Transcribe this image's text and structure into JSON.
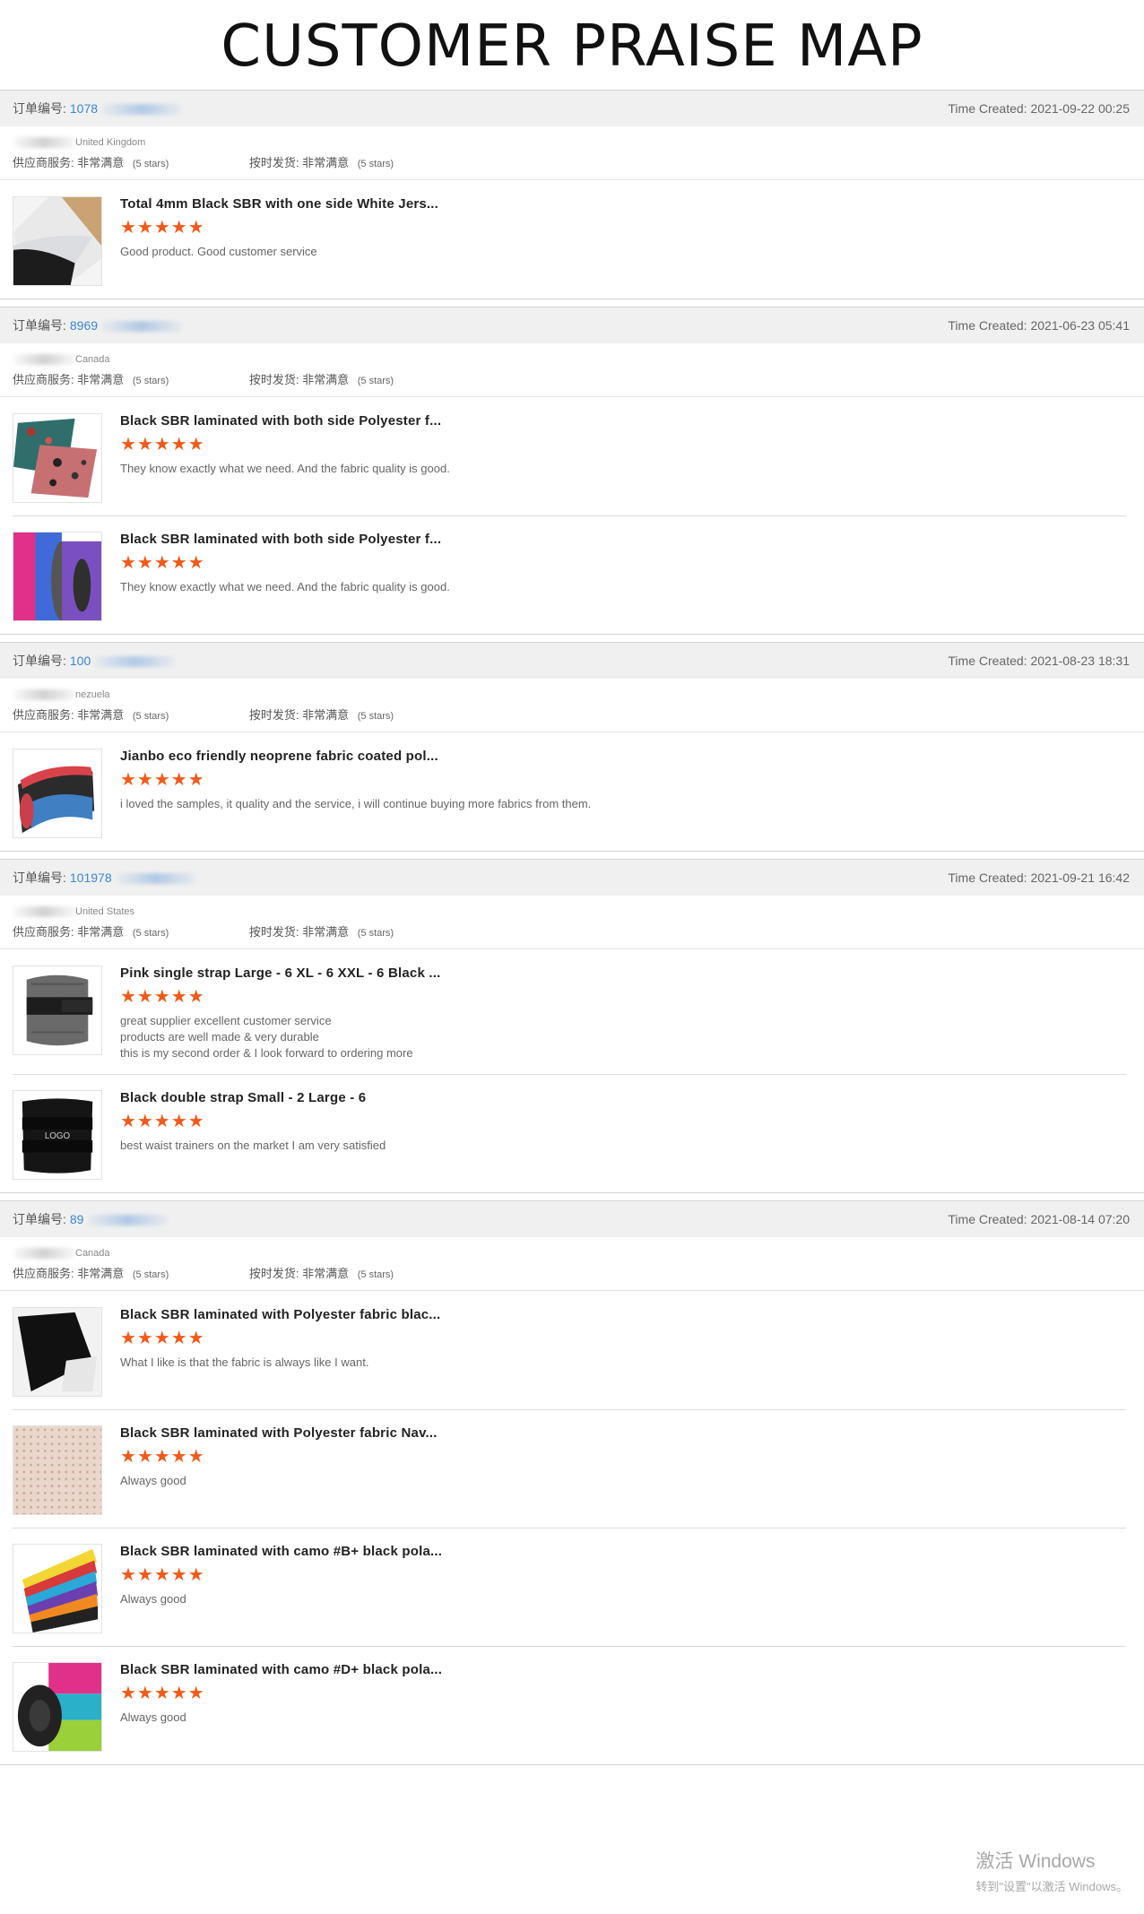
{
  "title": "CUSTOMER PRAISE MAP",
  "labels": {
    "order_no": "订单编号:",
    "supplier_service": "供应商服务:",
    "on_time_shipping": "按时发货:",
    "very_satisfied": "非常满意",
    "five_stars": "(5 stars)",
    "stars": "★★★★★"
  },
  "colors": {
    "accent": "#f05a1a",
    "link": "#3b86d6"
  },
  "orders": [
    {
      "order_id": "1078",
      "time": "Time Created: 2021-09-22 00:25",
      "country": "United Kingdom",
      "items": [
        {
          "title": "Total 4mm Black SBR with one side White Jers...",
          "comment": "Good product. Good customer service",
          "thumb": "sbr-white-jersey"
        }
      ]
    },
    {
      "order_id": "8969",
      "time": "Time Created: 2021-06-23 05:41",
      "country": "Canada",
      "items": [
        {
          "title": "Black SBR laminated with both side Polyester f...",
          "comment": "They know exactly what we need. And the fabric quality is good.",
          "thumb": "printed-fabric"
        },
        {
          "title": "Black SBR laminated with both side Polyester f...",
          "comment": "They know exactly what we need. And the fabric quality is good.",
          "thumb": "color-rolls"
        }
      ]
    },
    {
      "order_id": "100",
      "time": "Time Created: 2021-08-23 18:31",
      "country": "nezuela",
      "items": [
        {
          "title": "Jianbo eco friendly neoprene fabric coated pol...",
          "comment": "i loved the samples, it quality and the service, i will continue buying more fabrics from them.",
          "thumb": "coated-neoprene"
        }
      ]
    },
    {
      "order_id": "101978",
      "time": "Time Created: 2021-09-21 16:42",
      "country": "United States",
      "items": [
        {
          "title": "Pink single strap Large - 6 XL - 6 XXL - 6 Black ...",
          "comment": "great supplier excellent customer service\nproducts are well made & very durable\nthis is my second order & I look forward to ordering more",
          "thumb": "waist-trainer-gray"
        },
        {
          "title": "Black double strap Small - 2 Large - 6",
          "comment": "best waist trainers on the market I am very satisfied",
          "thumb": "waist-trainer-black",
          "logo_text": "LOGO"
        }
      ]
    },
    {
      "order_id": "89",
      "time": "Time Created: 2021-08-14 07:20",
      "country": "Canada",
      "items": [
        {
          "title": "Black SBR laminated with Polyester fabric blac...",
          "comment": "What I like is that the fabric is always like I want.",
          "thumb": "black-sheet"
        },
        {
          "title": "Black SBR laminated with Polyester fabric Nav...",
          "comment": "Always good",
          "thumb": "perforated"
        },
        {
          "title": "Black SBR laminated with camo #B+ black pola...",
          "comment": "Always good",
          "thumb": "stacked-colors"
        },
        {
          "title": "Black SBR laminated with camo #D+ black pola...",
          "comment": "Always good",
          "thumb": "rolled-colors"
        }
      ]
    }
  ],
  "watermark": {
    "line1": "激活 Windows",
    "line2": "转到\"设置\"以激活 Windows。"
  }
}
